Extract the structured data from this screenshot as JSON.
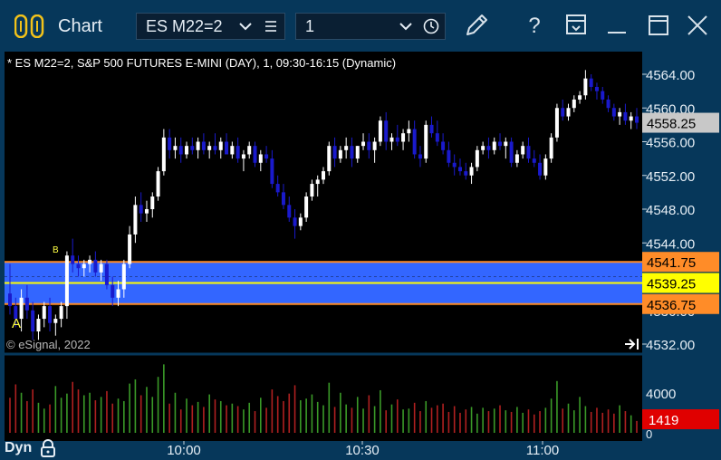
{
  "window": {
    "title": "Chart",
    "symbol": "ES M22=2",
    "interval": "1"
  },
  "chart_header": "* ES M22=2, S&P 500 FUTURES E-MINI (DAY), 1, 09:30-16:15 (Dynamic)",
  "copyright": "© eSignal, 2022",
  "footer": {
    "dyn_label": "Dyn"
  },
  "colors": {
    "background": "#000000",
    "frame": "#06375a",
    "up_candle": "#ffffff",
    "down_candle": "#1a1acc",
    "band_fill": "#3366ff",
    "band_line": "#ff8c28",
    "mid_line": "#ffff00",
    "volume_up": "#3a9a28",
    "volume_down": "#b02020"
  },
  "chart_data": {
    "type": "candlestick",
    "price_axis": {
      "ticks": [
        "4564.00",
        "4560.00",
        "4556.00",
        "4552.00",
        "4548.00",
        "4544.00",
        "4540.00",
        "4536.00",
        "4532.00"
      ],
      "range": [
        4531,
        4566
      ]
    },
    "volume_axis": {
      "ticks": [
        "4000",
        "0"
      ]
    },
    "time_axis": {
      "ticks": [
        "10:00",
        "10:30",
        "11:00"
      ]
    },
    "price_labels": [
      {
        "text": "4558.25",
        "value": 4558.25,
        "style": "last"
      },
      {
        "text": "4541.75",
        "value": 4541.75,
        "style": "orange"
      },
      {
        "text": "4539.25",
        "value": 4539.25,
        "style": "yellow"
      },
      {
        "text": "4536.75",
        "value": 4536.75,
        "style": "orange"
      }
    ],
    "volume_label": "1419",
    "band": {
      "upper": 4541.75,
      "mid": 4539.25,
      "lower": 4536.75
    },
    "markers": [
      {
        "text": "A"
      },
      {
        "text": "B"
      }
    ],
    "ohlc": [
      [
        4538.0,
        4541.5,
        4535.5,
        4536.5
      ],
      [
        4536.5,
        4537.5,
        4534.0,
        4535.0
      ],
      [
        4535.0,
        4538.5,
        4533.5,
        4537.5
      ],
      [
        4537.5,
        4539.0,
        4535.0,
        4536.0
      ],
      [
        4536.0,
        4537.0,
        4532.5,
        4533.5
      ],
      [
        4533.5,
        4535.5,
        4532.5,
        4535.0
      ],
      [
        4535.0,
        4537.0,
        4534.0,
        4536.5
      ],
      [
        4536.5,
        4537.5,
        4533.5,
        4534.5
      ],
      [
        4534.5,
        4535.5,
        4533.0,
        4535.0
      ],
      [
        4535.0,
        4537.0,
        4534.0,
        4536.5
      ],
      [
        4536.5,
        4543.0,
        4535.0,
        4542.5
      ],
      [
        4542.5,
        4544.5,
        4540.5,
        4541.5
      ],
      [
        4541.5,
        4542.5,
        4540.0,
        4541.0
      ],
      [
        4541.0,
        4542.0,
        4540.0,
        4541.5
      ],
      [
        4541.5,
        4542.5,
        4540.5,
        4542.0
      ],
      [
        4542.0,
        4543.0,
        4540.0,
        4540.5
      ],
      [
        4540.5,
        4542.0,
        4539.5,
        4541.5
      ],
      [
        4541.5,
        4542.0,
        4538.5,
        4539.0
      ],
      [
        4539.0,
        4540.0,
        4536.5,
        4537.5
      ],
      [
        4537.5,
        4539.5,
        4536.5,
        4538.5
      ],
      [
        4538.5,
        4542.0,
        4537.5,
        4541.5
      ],
      [
        4541.5,
        4546.0,
        4541.0,
        4545.0
      ],
      [
        4545.0,
        4549.5,
        4544.0,
        4548.5
      ],
      [
        4548.5,
        4550.0,
        4546.5,
        4547.5
      ],
      [
        4547.5,
        4549.0,
        4546.5,
        4548.0
      ],
      [
        4548.0,
        4550.0,
        4547.0,
        4549.5
      ],
      [
        4549.5,
        4553.0,
        4549.0,
        4552.5
      ],
      [
        4552.5,
        4557.5,
        4552.0,
        4556.5
      ],
      [
        4556.5,
        4557.5,
        4554.0,
        4555.0
      ],
      [
        4555.0,
        4556.5,
        4554.0,
        4555.5
      ],
      [
        4555.5,
        4556.5,
        4553.5,
        4554.5
      ],
      [
        4554.5,
        4556.0,
        4554.0,
        4555.5
      ],
      [
        4555.5,
        4556.5,
        4554.5,
        4555.0
      ],
      [
        4555.0,
        4556.5,
        4554.0,
        4556.0
      ],
      [
        4556.0,
        4557.0,
        4554.5,
        4555.0
      ],
      [
        4555.0,
        4556.0,
        4554.0,
        4555.5
      ],
      [
        4555.5,
        4557.0,
        4554.5,
        4555.0
      ],
      [
        4555.0,
        4556.5,
        4554.0,
        4556.0
      ],
      [
        4556.0,
        4557.0,
        4554.5,
        4554.5
      ],
      [
        4554.5,
        4556.0,
        4554.0,
        4555.5
      ],
      [
        4555.5,
        4556.5,
        4553.5,
        4554.0
      ],
      [
        4554.0,
        4555.0,
        4552.5,
        4554.5
      ],
      [
        4554.5,
        4556.0,
        4554.0,
        4555.5
      ],
      [
        4555.5,
        4556.0,
        4553.0,
        4553.5
      ],
      [
        4553.5,
        4555.0,
        4552.5,
        4554.5
      ],
      [
        4554.5,
        4555.5,
        4553.5,
        4554.0
      ],
      [
        4554.0,
        4555.0,
        4550.5,
        4551.0
      ],
      [
        4551.0,
        4552.0,
        4549.5,
        4550.0
      ],
      [
        4550.0,
        4551.0,
        4548.0,
        4548.5
      ],
      [
        4548.5,
        4549.5,
        4546.5,
        4547.0
      ],
      [
        4547.0,
        4548.0,
        4544.5,
        4546.0
      ],
      [
        4546.0,
        4547.5,
        4545.5,
        4547.0
      ],
      [
        4547.0,
        4550.0,
        4546.5,
        4549.5
      ],
      [
        4549.5,
        4551.5,
        4549.0,
        4551.0
      ],
      [
        4551.0,
        4552.0,
        4549.5,
        4551.5
      ],
      [
        4551.5,
        4553.0,
        4551.0,
        4552.5
      ],
      [
        4552.5,
        4556.0,
        4552.0,
        4555.5
      ],
      [
        4555.5,
        4556.5,
        4553.0,
        4554.0
      ],
      [
        4554.0,
        4555.5,
        4553.5,
        4555.0
      ],
      [
        4555.0,
        4556.5,
        4554.0,
        4555.5
      ],
      [
        4555.5,
        4556.5,
        4553.0,
        4554.0
      ],
      [
        4554.0,
        4555.5,
        4553.5,
        4555.5
      ],
      [
        4555.5,
        4557.0,
        4555.0,
        4556.0
      ],
      [
        4556.0,
        4557.0,
        4554.0,
        4555.0
      ],
      [
        4555.0,
        4556.5,
        4553.5,
        4556.0
      ],
      [
        4556.0,
        4559.0,
        4555.5,
        4558.5
      ],
      [
        4558.5,
        4559.5,
        4555.0,
        4556.0
      ],
      [
        4556.0,
        4557.0,
        4555.0,
        4556.5
      ],
      [
        4556.5,
        4558.0,
        4555.5,
        4556.0
      ],
      [
        4556.0,
        4557.5,
        4555.0,
        4557.0
      ],
      [
        4557.0,
        4558.5,
        4556.0,
        4557.5
      ],
      [
        4557.5,
        4558.5,
        4554.0,
        4554.5
      ],
      [
        4554.5,
        4555.5,
        4553.0,
        4554.0
      ],
      [
        4554.0,
        4558.5,
        4553.5,
        4558.0
      ],
      [
        4558.0,
        4559.0,
        4556.5,
        4557.0
      ],
      [
        4557.0,
        4558.5,
        4555.5,
        4556.0
      ],
      [
        4556.0,
        4557.0,
        4554.5,
        4555.0
      ],
      [
        4555.0,
        4556.0,
        4553.0,
        4553.5
      ],
      [
        4553.5,
        4554.5,
        4552.0,
        4553.0
      ],
      [
        4553.0,
        4554.0,
        4552.0,
        4552.5
      ],
      [
        4552.5,
        4553.5,
        4551.5,
        4552.0
      ],
      [
        4552.0,
        4553.5,
        4551.0,
        4553.0
      ],
      [
        4553.0,
        4555.5,
        4552.5,
        4555.0
      ],
      [
        4555.0,
        4556.0,
        4554.5,
        4555.5
      ],
      [
        4555.5,
        4556.5,
        4554.0,
        4555.0
      ],
      [
        4555.0,
        4556.5,
        4554.5,
        4556.0
      ],
      [
        4556.0,
        4557.0,
        4555.0,
        4555.5
      ],
      [
        4555.5,
        4556.5,
        4554.0,
        4556.0
      ],
      [
        4556.0,
        4556.5,
        4553.0,
        4553.5
      ],
      [
        4553.5,
        4555.0,
        4553.0,
        4554.5
      ],
      [
        4554.5,
        4556.0,
        4554.0,
        4555.5
      ],
      [
        4555.5,
        4556.5,
        4553.5,
        4554.0
      ],
      [
        4554.0,
        4555.0,
        4553.0,
        4553.5
      ],
      [
        4553.5,
        4554.5,
        4551.5,
        4552.0
      ],
      [
        4552.0,
        4554.5,
        4551.5,
        4554.0
      ],
      [
        4554.0,
        4557.0,
        4553.5,
        4556.5
      ],
      [
        4556.5,
        4560.5,
        4556.0,
        4560.0
      ],
      [
        4560.0,
        4561.0,
        4558.5,
        4559.0
      ],
      [
        4559.0,
        4560.5,
        4558.5,
        4560.0
      ],
      [
        4560.0,
        4561.5,
        4559.5,
        4561.0
      ],
      [
        4561.0,
        4562.0,
        4560.5,
        4561.5
      ],
      [
        4561.5,
        4564.5,
        4561.0,
        4563.5
      ],
      [
        4563.5,
        4564.0,
        4562.0,
        4562.5
      ],
      [
        4562.5,
        4563.0,
        4561.0,
        4562.0
      ],
      [
        4562.0,
        4562.5,
        4560.5,
        4561.0
      ],
      [
        4561.0,
        4561.5,
        4559.5,
        4560.0
      ],
      [
        4560.0,
        4560.5,
        4558.5,
        4559.0
      ],
      [
        4559.0,
        4560.0,
        4558.0,
        4559.5
      ],
      [
        4559.5,
        4560.5,
        4558.0,
        4558.5
      ],
      [
        4558.5,
        4559.5,
        4557.5,
        4559.0
      ],
      [
        4559.0,
        4560.0,
        4557.5,
        4558.25
      ]
    ],
    "volume": [
      4200,
      5800,
      4800,
      3800,
      5200,
      3600,
      2900,
      3400,
      5600,
      4200,
      4700,
      6100,
      5200,
      4500,
      4800,
      3900,
      4300,
      5000,
      3500,
      4100,
      3800,
      5900,
      6400,
      4500,
      5500,
      4300,
      6700,
      8200,
      3500,
      4800,
      2800,
      4100,
      3300,
      3700,
      3100,
      4600,
      4000,
      3800,
      3300,
      3500,
      3200,
      2800,
      3600,
      2600,
      4200,
      3000,
      5200,
      4400,
      3800,
      4700,
      5700,
      3900,
      4100,
      4600,
      3700,
      3300,
      6000,
      3100,
      4800,
      3400,
      3000,
      4300,
      2900,
      4500,
      3200,
      5100,
      2700,
      3400,
      4000,
      2800,
      2900,
      3600,
      2600,
      3800,
      3000,
      3300,
      3500,
      2500,
      3200,
      2400,
      2800,
      3100,
      2300,
      3000,
      2600,
      2900,
      3300,
      2700,
      2500,
      3100,
      2400,
      2800,
      2200,
      2600,
      3000,
      4100,
      6200,
      2900,
      3500,
      2700,
      4300,
      3200,
      2500,
      3000,
      2400,
      2800,
      2300,
      3300,
      2600,
      2100,
      1419
    ]
  }
}
